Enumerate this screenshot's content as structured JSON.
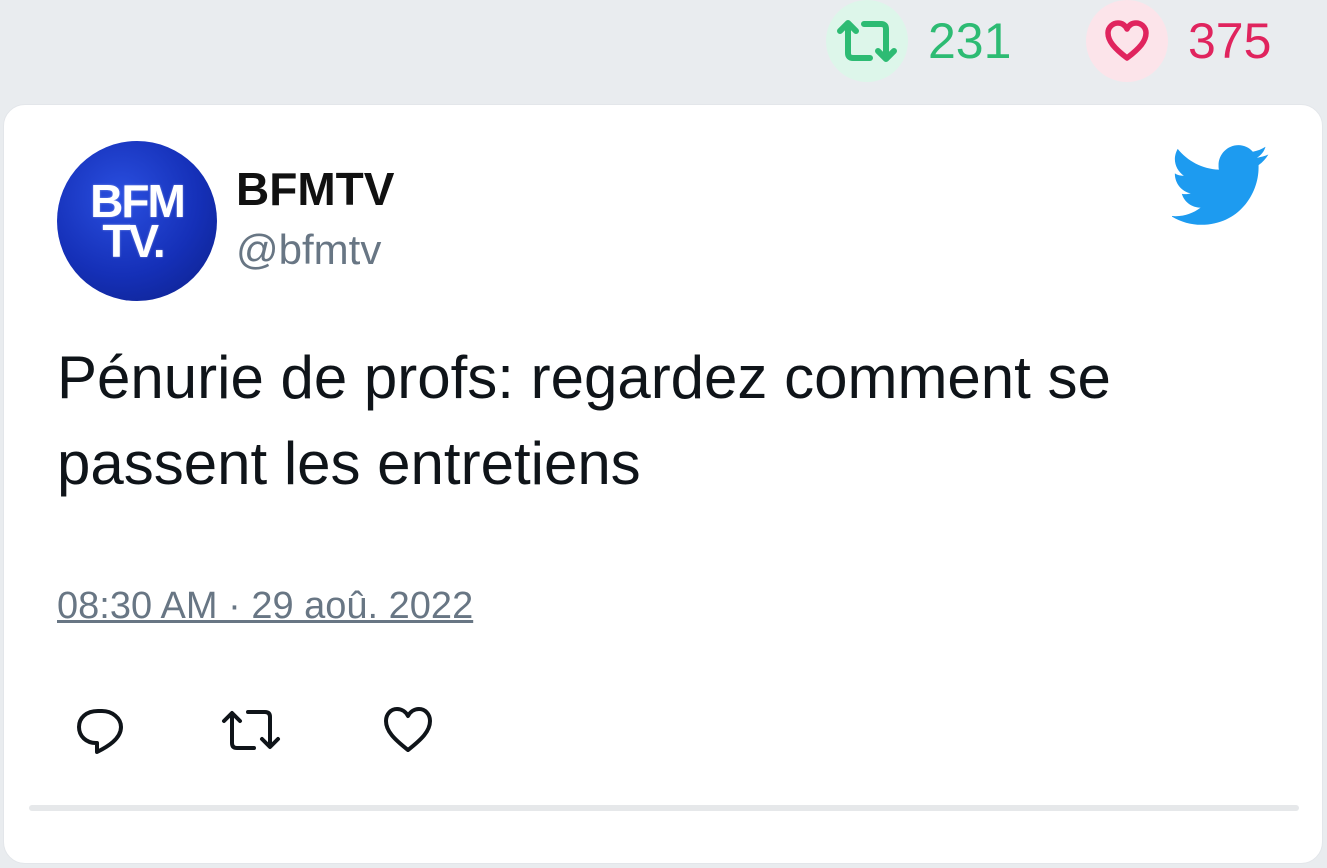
{
  "header_stats": {
    "retweets": "231",
    "likes": "375",
    "retweet_icon": "retweet-icon",
    "like_icon": "heart-icon",
    "retweet_color": "#2dbb73",
    "like_color": "#e0245e"
  },
  "tweet": {
    "avatar": {
      "line1": "BFM",
      "line2": "TV."
    },
    "display_name": "BFMTV",
    "handle": "@bfmtv",
    "text": "Pénurie de profs: regardez comment se passent les entretiens",
    "timestamp": "08:30 AM · 29 aoû. 2022",
    "brand_icon": "twitter-bird-icon",
    "brand_color": "#1d9bf0"
  },
  "actions": [
    {
      "icon": "reply-icon"
    },
    {
      "icon": "retweet-icon"
    },
    {
      "icon": "heart-icon"
    }
  ]
}
